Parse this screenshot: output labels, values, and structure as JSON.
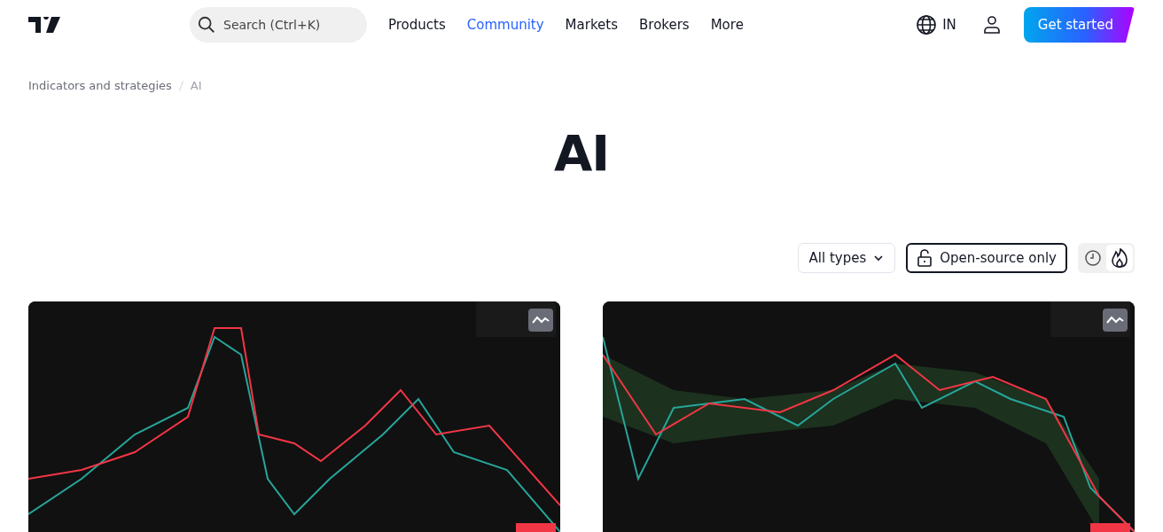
{
  "header": {
    "search": {
      "placeholder": "Search (Ctrl+K)"
    },
    "nav": [
      {
        "label": "Products",
        "selected": false
      },
      {
        "label": "Community",
        "selected": true
      },
      {
        "label": "Markets",
        "selected": false
      },
      {
        "label": "Brokers",
        "selected": false
      },
      {
        "label": "More",
        "selected": false
      }
    ],
    "region": "IN",
    "cta": "Get started"
  },
  "breadcrumb": [
    "Indicators and strategies",
    "AI"
  ],
  "title": "AI",
  "filters": {
    "type_select": "All types",
    "open_source": "Open-source only",
    "sort": [
      {
        "kind": "recent",
        "selected": false
      },
      {
        "kind": "popular",
        "selected": true
      }
    ]
  }
}
